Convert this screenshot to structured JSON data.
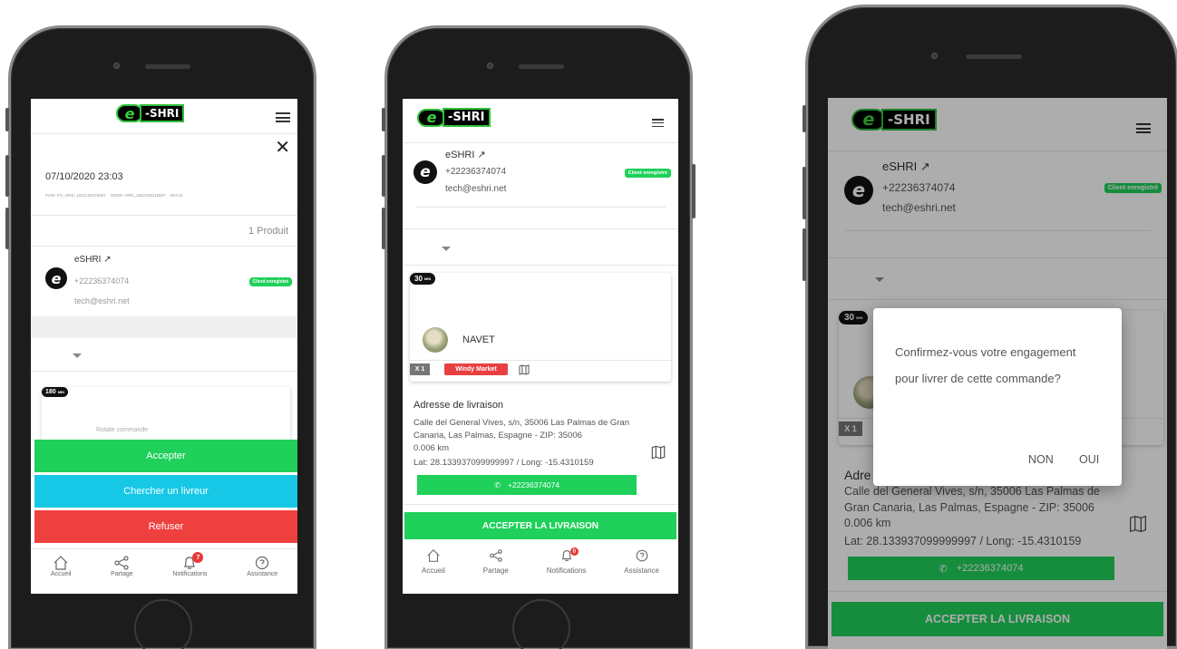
{
  "brand": {
    "logo_letter": "e",
    "logo_text": "-SHRI"
  },
  "colors": {
    "green": "#1fd05a",
    "cyan": "#17c8e6",
    "red": "#ef4040",
    "badge": "#e53935"
  },
  "customer": {
    "name": "eSHRI",
    "phone": "+22236374074",
    "email": "tech@eshri.net",
    "tag": "Client enregistré",
    "avatar_letter": "e"
  },
  "screen1": {
    "datetime": "07/10/2020 23:03",
    "refs": "POM: PO_ORD_1602108218807    ORDR: ORD_1602108218807    WH:03",
    "product_count": "1 Produit",
    "timer": "180",
    "timer_unit": "MIN",
    "hidden_line": "Rotate commande",
    "buttons": {
      "accept": "Accepter",
      "find_driver": "Chercher un livreur",
      "refuse": "Refuser"
    },
    "nav": [
      {
        "label": "Accueil",
        "icon": "home-icon"
      },
      {
        "label": "Partage",
        "icon": "share-icon"
      },
      {
        "label": "Notifications",
        "icon": "bell-icon",
        "badge": "7"
      },
      {
        "label": "Assistance",
        "icon": "help-icon"
      }
    ]
  },
  "screen2": {
    "timer": "30",
    "timer_unit": "MIN",
    "product_name": "NAVET",
    "qty": "X 1",
    "market": "Windy Market",
    "address_title": "Adresse de livraison",
    "address_line": "Calle del General Vives, s/n, 35006 Las Palmas de Gran Canaria, Las Palmas, Espagne - ZIP: 35006",
    "distance": "0.006 km",
    "coords": "Lat: 28.133937099999997 / Long: -15.4310159",
    "call_phone": "+22236374074",
    "cta": "ACCEPTER LA LIVRAISON",
    "nav": [
      {
        "label": "Accueil",
        "icon": "home-icon"
      },
      {
        "label": "Partage",
        "icon": "share-icon"
      },
      {
        "label": "Notifications",
        "icon": "bell-icon",
        "badge": "0"
      },
      {
        "label": "Assistance",
        "icon": "help-icon"
      }
    ]
  },
  "screen3": {
    "dialog_text": "Confirmez-vous votre engagement pour livrer de cette commande?",
    "dialog_no": "NON",
    "dialog_yes": "OUI",
    "address_title_partial": "Adre"
  }
}
